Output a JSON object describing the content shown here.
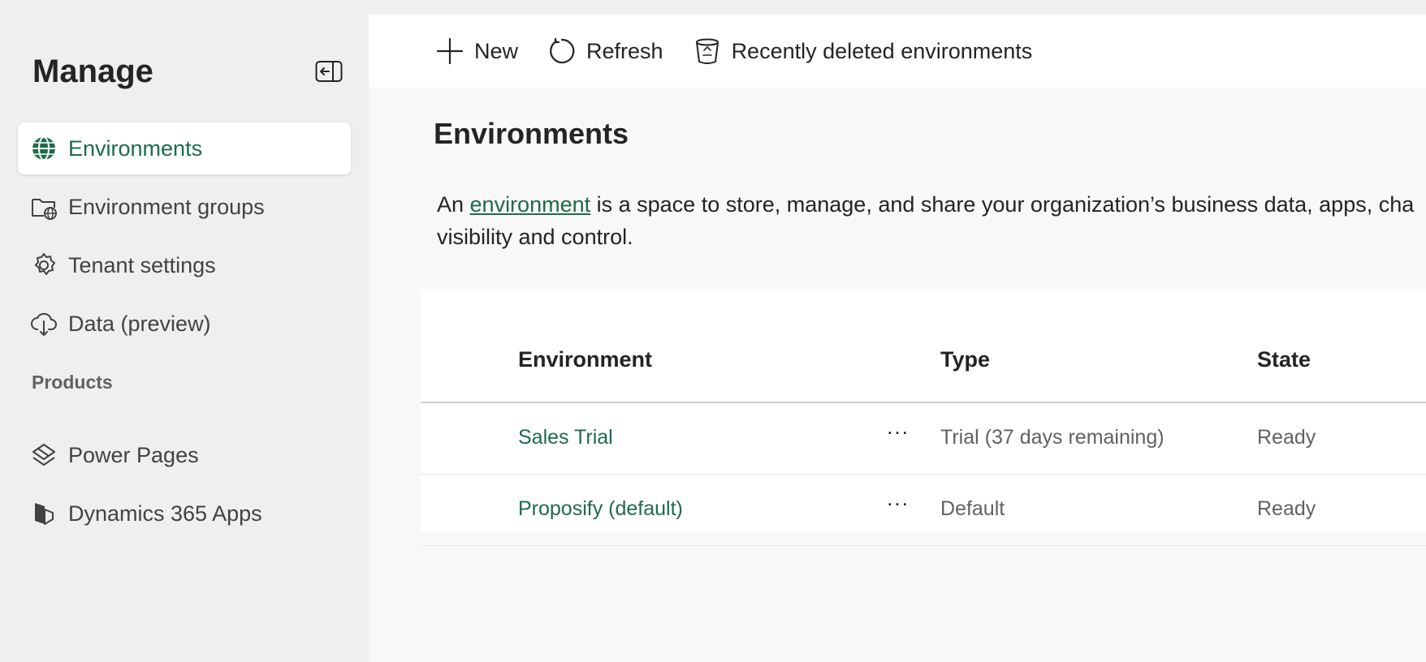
{
  "sidebar": {
    "title": "Manage",
    "items": [
      {
        "label": "Environments",
        "icon": "globe-icon",
        "active": true
      },
      {
        "label": "Environment groups",
        "icon": "folder-globe-icon"
      },
      {
        "label": "Tenant settings",
        "icon": "gear-icon"
      },
      {
        "label": "Data (preview)",
        "icon": "cloud-icon"
      }
    ],
    "section": "Products",
    "products": [
      {
        "label": "Power Pages",
        "icon": "power-pages-icon"
      },
      {
        "label": "Dynamics 365 Apps",
        "icon": "dynamics-icon"
      }
    ]
  },
  "toolbar": {
    "new_label": "New",
    "refresh_label": "Refresh",
    "deleted_label": "Recently deleted environments"
  },
  "main": {
    "title": "Environments",
    "description": {
      "prefix": "An ",
      "link": "environment",
      "line1_rest": " is a space to store, manage, and share your organization’s business data, apps, cha",
      "line2": "visibility and control."
    }
  },
  "table": {
    "headers": [
      "Environment",
      "Type",
      "State"
    ],
    "rows": [
      {
        "name": "Sales Trial",
        "more": "...",
        "type": "Trial (37 days remaining)",
        "state": "Ready"
      },
      {
        "name": "Proposify (default)",
        "more": "...",
        "type": "Default",
        "state": "Ready"
      }
    ]
  },
  "colors": {
    "accent": "#1d6b4b",
    "sidebar_bg": "#efefef",
    "content_bg": "#f8f8f8"
  }
}
